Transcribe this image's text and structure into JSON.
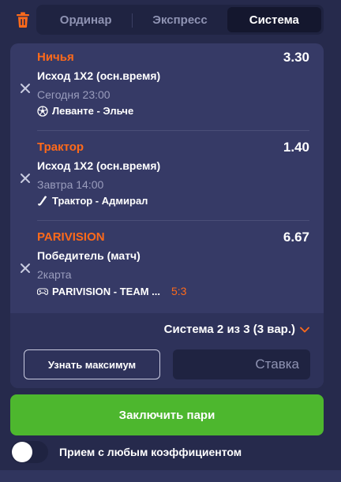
{
  "tabs": [
    {
      "label": "Ординар"
    },
    {
      "label": "Экспресс"
    },
    {
      "label": "Система"
    }
  ],
  "active_tab": "Система",
  "bets": [
    {
      "title": "Ничья",
      "odds": "3.30",
      "market": "Исход 1X2 (осн.время)",
      "time": "Сегодня 23:00",
      "match": "Леванте - Эльче",
      "sport_icon": "soccer-ball-icon",
      "score": ""
    },
    {
      "title": "Трактор",
      "odds": "1.40",
      "market": "Исход 1X2 (осн.время)",
      "time": "Завтра 14:00",
      "match": "Трактор - Адмирал",
      "sport_icon": "hockey-stick-icon",
      "score": ""
    },
    {
      "title": "PARIVISION",
      "odds": "6.67",
      "market": "Победитель (матч)",
      "time": "2карта",
      "match": "PARIVISION - TEAM ...",
      "sport_icon": "gamepad-icon",
      "score": "5:3"
    }
  ],
  "system": {
    "selected": "Система 2 из 3 (3 вар.)",
    "max_label": "Узнать максимум",
    "stake_placeholder": "Ставка",
    "stake_value": ""
  },
  "place_bet_label": "Заключить пари",
  "accept_any_odds_label": "Прием с любым коэффициентом",
  "accept_any_odds_on": false,
  "colors": {
    "background": "#262a4c",
    "card": "#363a66",
    "accent_orange": "#ff6a1a",
    "place_green": "#4db72e"
  }
}
